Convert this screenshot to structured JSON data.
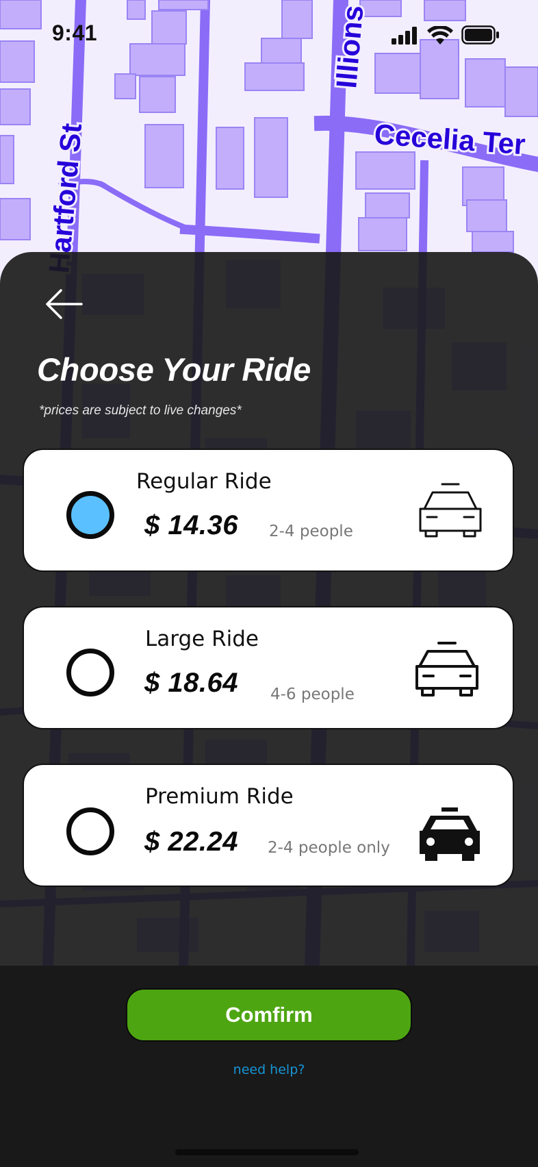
{
  "status_bar": {
    "time": "9:41"
  },
  "map": {
    "streets": [
      "Hartford St",
      "Illions St",
      "Cecelia Ter"
    ],
    "land_color": "#f3eefe",
    "road_color": "#8a6cf7",
    "building_color": "#c2aefb"
  },
  "header": {
    "back_icon": "arrow-left-icon",
    "title": "Choose Your Ride",
    "subtitle": "*prices are subject to live changes*"
  },
  "rides": [
    {
      "name": "Regular Ride",
      "price": "$ 14.36",
      "capacity": "2-4 people",
      "selected": true,
      "icon": "car-outline-icon"
    },
    {
      "name": "Large Ride",
      "price": "$ 18.64",
      "capacity": "4-6 people",
      "selected": false,
      "icon": "car-large-outline-icon"
    },
    {
      "name": "Premium Ride",
      "price": "$ 22.24",
      "capacity": "2-4 people only",
      "selected": false,
      "icon": "car-filled-icon"
    }
  ],
  "confirm_label": "Comfirm",
  "help_label": "need help?",
  "colors": {
    "accent": "#4ea512",
    "selected_radio": "#5bc0ff",
    "link": "#1795d6",
    "sheet": "#191919"
  }
}
